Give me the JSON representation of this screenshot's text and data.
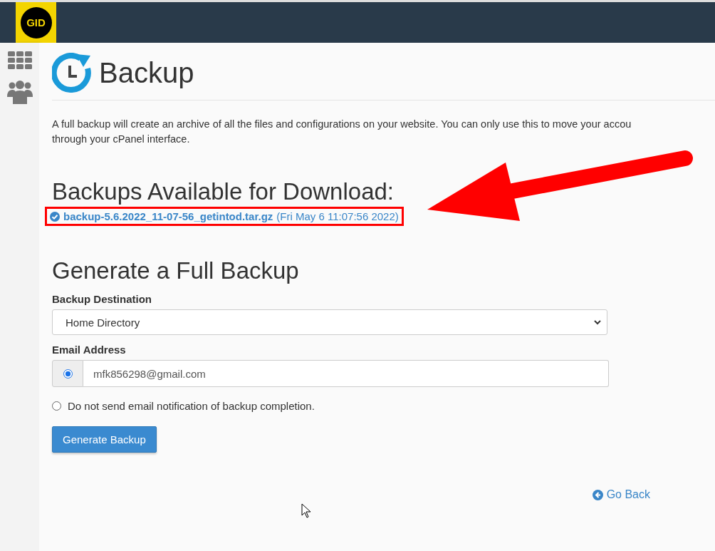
{
  "header": {
    "logo": "GID"
  },
  "page": {
    "title": "Backup",
    "intro": [
      "A full backup will create an archive of all the files and configurations on your website. You can only use this to move your accou",
      "through your cPanel interface."
    ]
  },
  "downloads": {
    "heading": "Backups Available for Download:",
    "items": [
      {
        "file": "backup-5.6.2022_11-07-56_getintod.tar.gz",
        "date": "(Fri May 6 11:07:56 2022)"
      }
    ]
  },
  "generate": {
    "heading": "Generate a Full Backup",
    "destination_label": "Backup Destination",
    "destination": "Home Directory",
    "email_label": "Email Address",
    "email_options": [
      {
        "kind": "email",
        "selected": true,
        "value": "mfk856298@gmail.com"
      },
      {
        "kind": "none",
        "selected": false,
        "label": "Do not send email notification of backup completion."
      }
    ],
    "button": "Generate Backup"
  },
  "go_back": "Go Back"
}
